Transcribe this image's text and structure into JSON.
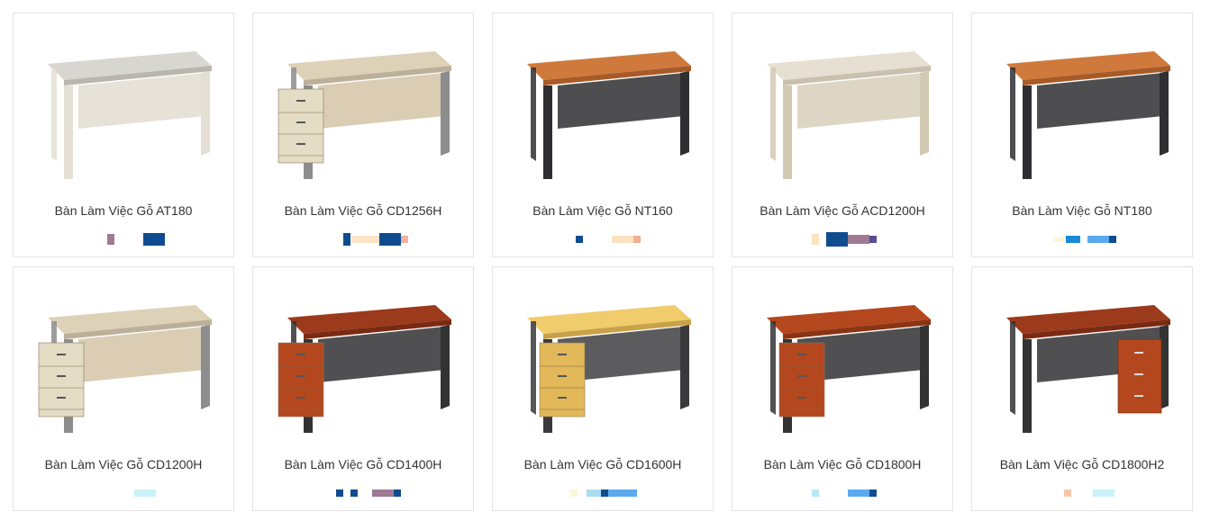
{
  "products": [
    {
      "name": "Bàn Làm Việc Gỗ AT180",
      "style": "white-panel",
      "swatches": [
        {
          "c": "#a07a94"
        },
        {
          "c": "#0f4c8f"
        }
      ]
    },
    {
      "name": "Bàn Làm Việc Gỗ CD1256H",
      "style": "beige-drawer-left",
      "swatches": [
        {
          "c": "#0f4c8f"
        },
        {
          "c": "#fbe4c4"
        },
        {
          "c": "#fbe4c4"
        },
        {
          "c": "#0f4c8f"
        },
        {
          "c": "#f2b0a0"
        }
      ]
    },
    {
      "name": "Bàn Làm Việc Gỗ NT160",
      "style": "cherry-dark",
      "swatches": [
        {
          "c": "#0f4c8f"
        },
        {
          "c": "#fde2c0"
        },
        {
          "c": "#f0b090"
        }
      ]
    },
    {
      "name": "Bàn Làm Việc Gỗ ACD1200H",
      "style": "white-plain",
      "swatches": [
        {
          "c": "#fde2c0"
        },
        {
          "c": "#0f4c8f"
        },
        {
          "c": "#a07a94"
        },
        {
          "c": "#5a4a8f"
        }
      ]
    },
    {
      "name": "Bàn Làm Việc Gỗ NT180",
      "style": "cherry-dark",
      "swatches": [
        {
          "c": "#fdf6d8"
        },
        {
          "c": "#1a8ad8"
        },
        {
          "c": "#5aaaf0"
        },
        {
          "c": "#0f4c8f"
        }
      ]
    },
    {
      "name": "Bàn Làm Việc Gỗ CD1200H",
      "style": "beige-drawer-left",
      "swatches": [
        {
          "c": "#c8f2f8"
        }
      ]
    },
    {
      "name": "Bàn Làm Việc Gỗ CD1400H",
      "style": "red-drawer-left",
      "swatches": [
        {
          "c": "#0f4c8f"
        },
        {
          "c": "#0f4c8f"
        },
        {
          "c": "#a07a94"
        },
        {
          "c": "#0f4c8f"
        }
      ]
    },
    {
      "name": "Bàn Làm Việc Gỗ CD1600H",
      "style": "yellow-drawer",
      "swatches": [
        {
          "c": "#fdf6d8"
        },
        {
          "c": "#a8dcf0"
        },
        {
          "c": "#0f4c8f"
        },
        {
          "c": "#5aaaf0"
        }
      ]
    },
    {
      "name": "Bàn Làm Việc Gỗ CD1800H",
      "style": "red-drawer-mid",
      "swatches": [
        {
          "c": "#b8e8f8"
        },
        {
          "c": "#5aaaf0"
        },
        {
          "c": "#0f4c8f"
        }
      ]
    },
    {
      "name": "Bàn Làm Việc Gỗ CD1800H2",
      "style": "red-drawer-right",
      "swatches": [
        {
          "c": "#f8c8a8"
        },
        {
          "c": "#c8f2f8"
        }
      ]
    }
  ]
}
